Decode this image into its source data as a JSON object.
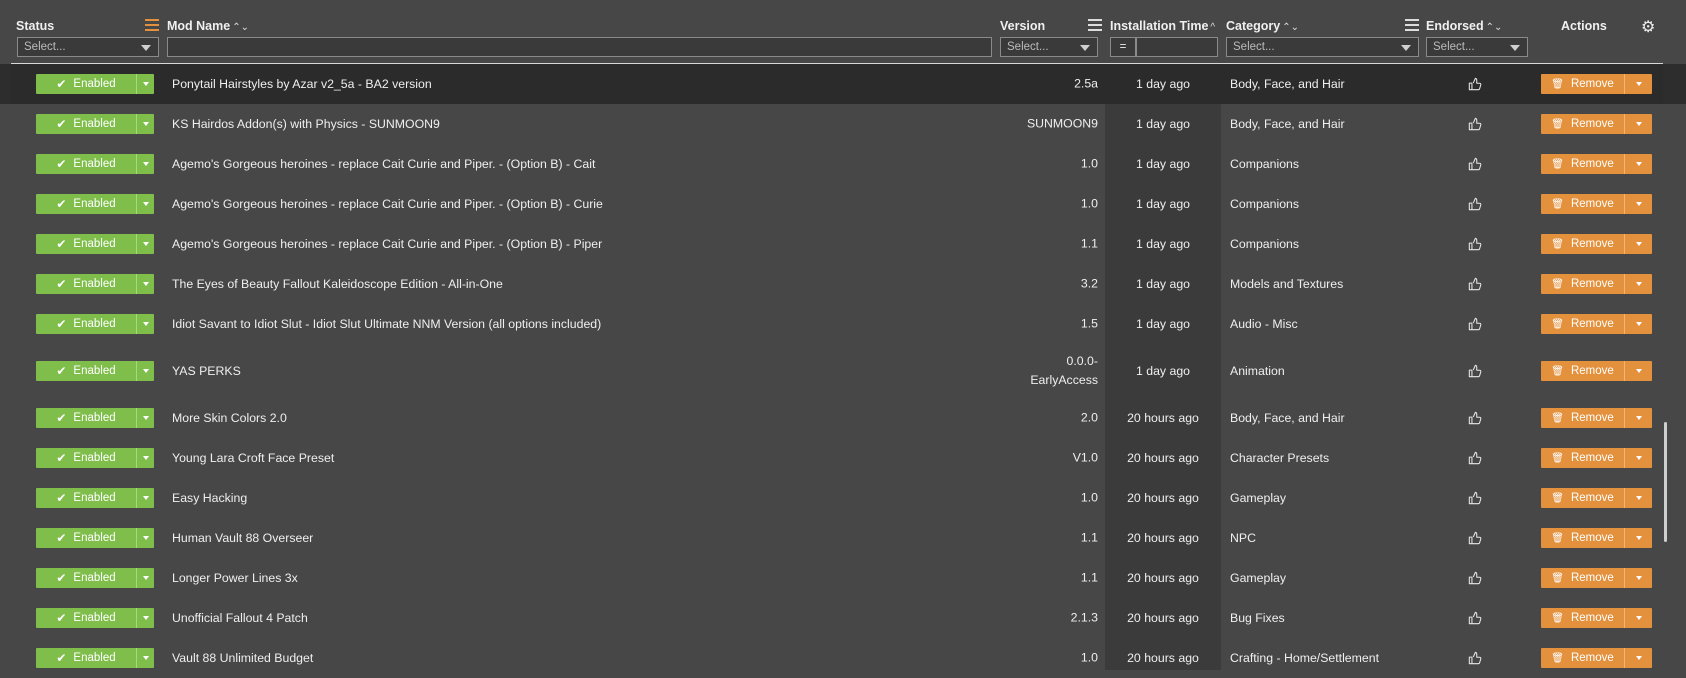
{
  "header": {
    "status": "Status",
    "mod_name": "Mod Name",
    "version": "Version",
    "installation_time": "Installation Time",
    "category": "Category",
    "endorsed": "Endorsed",
    "actions": "Actions",
    "sort_unsorted": "⌃⌄",
    "sort_asc": "^",
    "filters": {
      "status_placeholder": "Select...",
      "version_placeholder": "Select...",
      "category_placeholder": "Select...",
      "endorsed_placeholder": "Select...",
      "mod_name_value": "",
      "install_op": "=",
      "install_value": ""
    }
  },
  "colors": {
    "enabled": "#80be4b",
    "remove": "#e4913d",
    "filter_active": "#e4913d"
  },
  "rows": [
    {
      "status": "Enabled",
      "name": "Ponytail Hairstyles by Azar v2_5a - BA2 version",
      "version": "2.5a",
      "installed": "1 day ago",
      "category": "Body, Face, and Hair",
      "action": "Remove"
    },
    {
      "status": "Enabled",
      "name": "KS Hairdos Addon(s) with Physics - SUNMOON9",
      "version": "SUNMOON9",
      "installed": "1 day ago",
      "category": "Body, Face, and Hair",
      "action": "Remove"
    },
    {
      "status": "Enabled",
      "name": "Agemo's Gorgeous heroines - replace Cait Curie and Piper. - (Option B) - Cait",
      "version": "1.0",
      "installed": "1 day ago",
      "category": "Companions",
      "action": "Remove"
    },
    {
      "status": "Enabled",
      "name": "Agemo's Gorgeous heroines - replace Cait Curie and Piper. - (Option B) - Curie",
      "version": "1.0",
      "installed": "1 day ago",
      "category": "Companions",
      "action": "Remove"
    },
    {
      "status": "Enabled",
      "name": "Agemo's Gorgeous heroines - replace Cait Curie and Piper. - (Option B) - Piper",
      "version": "1.1",
      "installed": "1 day ago",
      "category": "Companions",
      "action": "Remove"
    },
    {
      "status": "Enabled",
      "name": "The Eyes of Beauty Fallout Kaleidoscope Edition - All-in-One",
      "version": "3.2",
      "installed": "1 day ago",
      "category": "Models and Textures",
      "action": "Remove"
    },
    {
      "status": "Enabled",
      "name": "Idiot Savant to Idiot Slut - Idiot Slut Ultimate NNM Version (all options included)",
      "version": "1.5",
      "installed": "1 day ago",
      "category": "Audio - Misc",
      "action": "Remove"
    },
    {
      "status": "Enabled",
      "name": "YAS PERKS",
      "version": "0.0.0-",
      "version2": "EarlyAccess",
      "installed": "1 day ago",
      "category": "Animation",
      "action": "Remove"
    },
    {
      "status": "Enabled",
      "name": "More Skin Colors 2.0",
      "version": "2.0",
      "installed": "20 hours ago",
      "category": "Body, Face, and Hair",
      "action": "Remove"
    },
    {
      "status": "Enabled",
      "name": "Young Lara Croft Face Preset",
      "version": "V1.0",
      "installed": "20 hours ago",
      "category": "Character Presets",
      "action": "Remove"
    },
    {
      "status": "Enabled",
      "name": "Easy Hacking",
      "version": "1.0",
      "installed": "20 hours ago",
      "category": "Gameplay",
      "action": "Remove"
    },
    {
      "status": "Enabled",
      "name": "Human Vault 88 Overseer",
      "version": "1.1",
      "installed": "20 hours ago",
      "category": "NPC",
      "action": "Remove"
    },
    {
      "status": "Enabled",
      "name": "Longer Power Lines 3x",
      "version": "1.1",
      "installed": "20 hours ago",
      "category": "Gameplay",
      "action": "Remove"
    },
    {
      "status": "Enabled",
      "name": "Unofficial Fallout 4 Patch",
      "version": "2.1.3",
      "installed": "20 hours ago",
      "category": "Bug Fixes",
      "action": "Remove"
    },
    {
      "status": "Enabled",
      "name": "Vault 88 Unlimited Budget",
      "version": "1.0",
      "installed": "20 hours ago",
      "category": "Crafting - Home/Settlement",
      "action": "Remove"
    }
  ]
}
